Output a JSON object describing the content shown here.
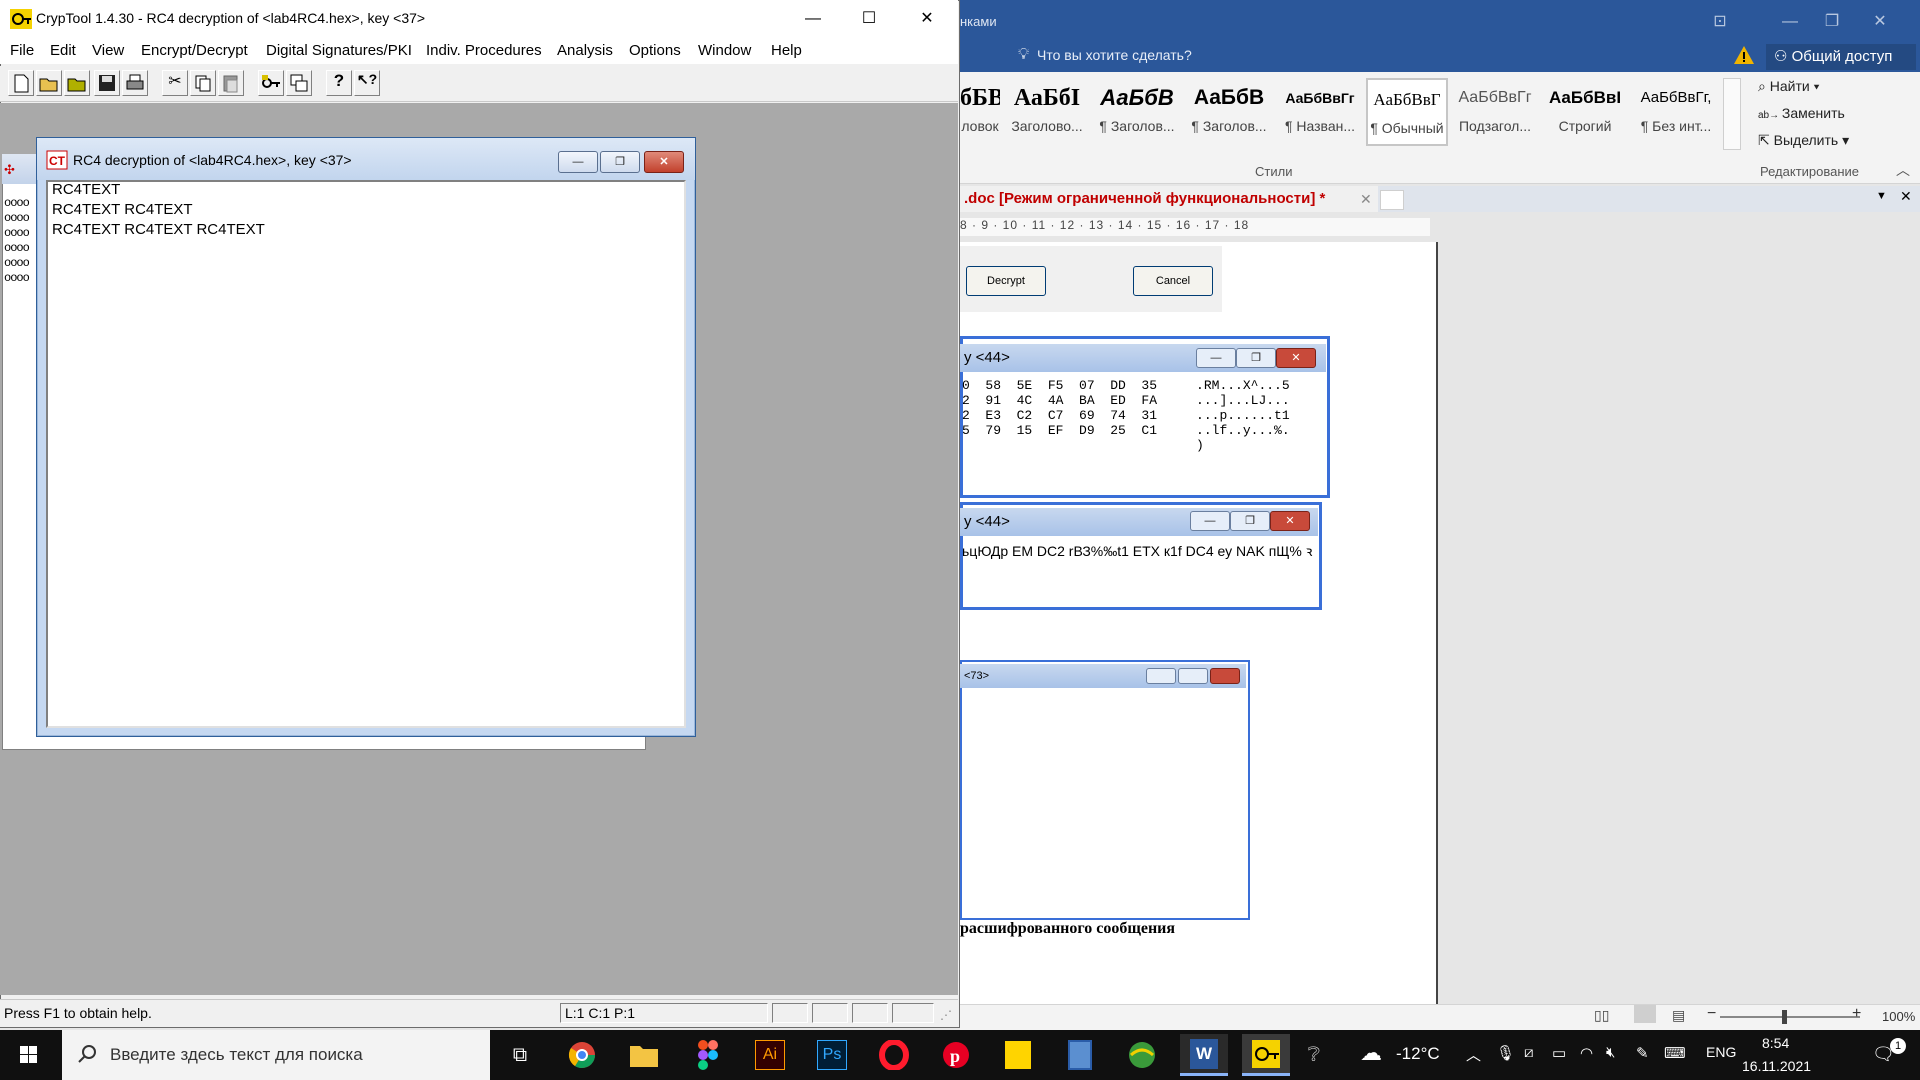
{
  "word": {
    "title_fragment": "нками",
    "tell_me": "Что вы хотите сделать?",
    "share": "Общий доступ",
    "styles": [
      {
        "preview": "бБВ",
        "name": "ловок"
      },
      {
        "preview": "АаБбІ",
        "name": "Заголово..."
      },
      {
        "preview": "АаБбВ",
        "name": "¶ Заголов..."
      },
      {
        "preview": "АаБбВ",
        "name": "¶ Заголов..."
      },
      {
        "preview": "АаБбВвГг",
        "name": "¶ Назван..."
      },
      {
        "preview": "АаБбВвГ",
        "name": "¶ Обычный"
      },
      {
        "preview": "АаБбВвГг",
        "name": "Подзагол..."
      },
      {
        "preview": "АаБбВвІ",
        "name": "Строгий"
      },
      {
        "preview": "АаБбВвГг,",
        "name": "¶ Без инт..."
      }
    ],
    "styles_group_label": "Стили",
    "editing": {
      "find": "Найти",
      "replace": "Заменить",
      "select": "Выделить",
      "group_label": "Редактирование"
    },
    "doc_tab": ".doc [Режим ограниченной функциональности] *",
    "ruler": "8 · 9 · 10 · 11 · 12 · 13 · 14 · 15 · 16 · 17 · 18",
    "decrypt_button": "Decrypt",
    "cancel_button": "Cancel",
    "hex_window_title": "y <44>",
    "hex_lines": [
      "0  58  5E  F5  07  DD  35     .RM...X^...5",
      "2  91  4C  4A  BA  ED  FA     ...]...LJ...",
      "2  E3  C2  C7  69  74  31     ...p......t1",
      "5  79  15  EF  D9  25  C1     ..lf..y...%.",
      "                              )"
    ],
    "text_window_title": "y <44>",
    "text_window_content": "ьцЮДр EM DC2 rВЗ%‰t1 ETX к1f DC4 еу NAK пЩ% ꝛ",
    "third_window_title": "<73>",
    "caption": "расшифрованного сообщения",
    "zoom": "100%"
  },
  "cryptool": {
    "title": "CrypTool 1.4.30 - RC4 decryption of <lab4RC4.hex>, key <37>",
    "menu": [
      "File",
      "Edit",
      "View",
      "Encrypt/Decrypt",
      "Digital Signatures/PKI",
      "Indiv. Procedures",
      "Analysis",
      "Options",
      "Window",
      "Help"
    ],
    "status_text": "Press F1 to obtain help.",
    "status_position": "L:1  C:1  P:1",
    "child_title": "RC4 decryption of <lab4RC4.hex>, key <37>",
    "child_lines": [
      "RC4TEXT",
      "RC4TEXT RC4TEXT",
      "RC4TEXT RC4TEXT RC4TEXT"
    ],
    "bg_child_rows": [
      "oooo",
      "oooo",
      "oooo",
      "oooo",
      "oooo",
      "oooo"
    ]
  },
  "taskbar": {
    "search_placeholder": "Введите здесь текст для поиска",
    "weather": "-12°C",
    "lang": "ENG",
    "time": "8:54",
    "date": "16.11.2021"
  },
  "colors": {
    "word_blue": "#2b579a",
    "mdi_gray": "#a9a9a9",
    "taskbar": "#101010"
  }
}
